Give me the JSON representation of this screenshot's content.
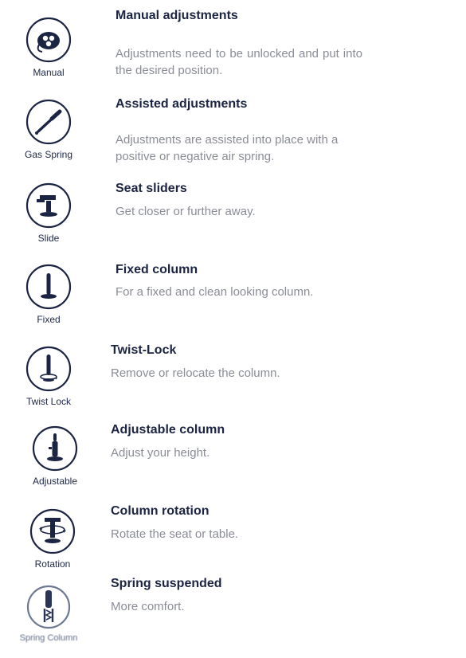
{
  "items": [
    {
      "icon": "manual-knob-icon",
      "label": "Manual",
      "title": "Manual adjustments",
      "desc": "Adjustments need to be unlocked and put into the desired position."
    },
    {
      "icon": "gas-spring-icon",
      "label": "Gas Spring",
      "title": "Assisted adjustments",
      "desc": "Adjustments are assisted into place with a positive or negative air spring."
    },
    {
      "icon": "seat-slider-icon",
      "label": "Slide",
      "title": "Seat sliders",
      "desc": "Get closer or further away."
    },
    {
      "icon": "fixed-column-icon",
      "label": "Fixed",
      "title": "Fixed column",
      "desc": "For a fixed and clean looking column."
    },
    {
      "icon": "twist-lock-icon",
      "label": "Twist Lock",
      "title": "Twist-Lock",
      "desc": "Remove or relocate the column."
    },
    {
      "icon": "adjustable-column-icon",
      "label": "Adjustable",
      "title": "Adjustable column",
      "desc": "Adjust your height."
    },
    {
      "icon": "rotation-icon",
      "label": "Rotation",
      "title": "Column rotation",
      "desc": "Rotate the seat or table."
    },
    {
      "icon": "spring-column-icon",
      "label": "Spring Column",
      "title": "Spring suspended",
      "desc": "More comfort."
    }
  ],
  "colors": {
    "ink": "#1b2442",
    "muted": "#8a8d96"
  }
}
